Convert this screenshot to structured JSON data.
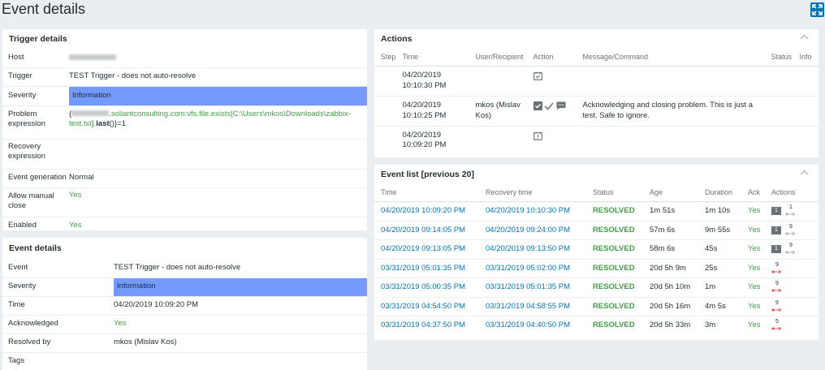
{
  "page": {
    "title": "Event details"
  },
  "trigger_details": {
    "title": "Trigger details",
    "rows": [
      {
        "key": "Host",
        "value": ""
      },
      {
        "key": "Trigger",
        "value": "TEST Trigger - does not auto-resolve"
      },
      {
        "key": "Severity",
        "value": "Information"
      },
      {
        "key": "Problem expression",
        "value_prefix": "{",
        "value_host": ".soliantconsulting.com:vfs.file.exists[C:\\Users\\mkos\\Downloads\\zabbix-test.txt].",
        "value_func": "last",
        "value_suffix": "()}=1"
      },
      {
        "key": "Recovery expression",
        "value": ""
      },
      {
        "key": "Event generation",
        "value": "Normal"
      },
      {
        "key": "Allow manual close",
        "value": "Yes"
      },
      {
        "key": "Enabled",
        "value": "Yes"
      }
    ]
  },
  "event_details": {
    "title": "Event details",
    "rows": [
      {
        "key": "Event",
        "value": "TEST Trigger - does not auto-resolve"
      },
      {
        "key": "Severity",
        "value": "Information"
      },
      {
        "key": "Time",
        "value": "04/20/2019 10:09:20 PM"
      },
      {
        "key": "Acknowledged",
        "value": "Yes"
      },
      {
        "key": "Resolved by",
        "value": "mkos (Mislav Kos)"
      },
      {
        "key": "Tags",
        "value": ""
      }
    ]
  },
  "actions": {
    "title": "Actions",
    "columns": [
      "Step",
      "Time",
      "User/Recipient",
      "Action",
      "Message/Command",
      "Status",
      "Info"
    ],
    "rows": [
      {
        "time_date": "04/20/2019",
        "time_clock": "10:10:30 PM",
        "user": "",
        "action_icons": [
          "calendar-check-icon"
        ],
        "message": ""
      },
      {
        "time_date": "04/20/2019",
        "time_clock": "10:10:25 PM",
        "user": "mkos (Mislav Kos)",
        "action_icons": [
          "checkbox-icon",
          "checkmark-icon",
          "comment-icon"
        ],
        "message": "Acknowledging and closing problem. This is just a test. Safe to ignore."
      },
      {
        "time_date": "04/20/2019",
        "time_clock": "10:09:20 PM",
        "user": "",
        "action_icons": [
          "calendar-exclamation-icon"
        ],
        "message": ""
      }
    ]
  },
  "event_list": {
    "title": "Event list [previous 20]",
    "columns": [
      "Time",
      "Recovery time",
      "Status",
      "Age",
      "Duration",
      "Ack",
      "Actions"
    ],
    "rows": [
      {
        "time": "04/20/2019 10:09:20 PM",
        "recovery": "04/20/2019 10:10:30 PM",
        "status": "RESOLVED",
        "age": "1m 51s",
        "duration": "1m 10s",
        "ack": "Yes",
        "msg_count": "1",
        "action_count": "1"
      },
      {
        "time": "04/20/2019 09:14:05 PM",
        "recovery": "04/20/2019 09:24:00 PM",
        "status": "RESOLVED",
        "age": "57m 6s",
        "duration": "9m 55s",
        "ack": "Yes",
        "msg_count": "1",
        "action_count": "9"
      },
      {
        "time": "04/20/2019 09:13:05 PM",
        "recovery": "04/20/2019 09:13:50 PM",
        "status": "RESOLVED",
        "age": "58m 6s",
        "duration": "45s",
        "ack": "Yes",
        "msg_count": "1",
        "action_count": "9"
      },
      {
        "time": "03/31/2019 05:01:35 PM",
        "recovery": "03/31/2019 05:02:00 PM",
        "status": "RESOLVED",
        "age": "20d 5h 9m",
        "duration": "25s",
        "ack": "Yes",
        "msg_count": "",
        "action_count": "9"
      },
      {
        "time": "03/31/2019 05:00:35 PM",
        "recovery": "03/31/2019 05:01:35 PM",
        "status": "RESOLVED",
        "age": "20d 5h 10m",
        "duration": "1m",
        "ack": "Yes",
        "msg_count": "",
        "action_count": "9"
      },
      {
        "time": "03/31/2019 04:54:50 PM",
        "recovery": "03/31/2019 04:58:55 PM",
        "status": "RESOLVED",
        "age": "20d 5h 16m",
        "duration": "4m 5s",
        "ack": "Yes",
        "msg_count": "",
        "action_count": "9"
      },
      {
        "time": "03/31/2019 04:37:50 PM",
        "recovery": "03/31/2019 04:40:50 PM",
        "status": "RESOLVED",
        "age": "20d 5h 33m",
        "duration": "3m",
        "ack": "Yes",
        "msg_count": "",
        "action_count": "5"
      }
    ]
  },
  "colors": {
    "severity_information": "#7499ff",
    "link": "#0275b8",
    "resolved": "#429e47",
    "accent": "#0275b8"
  }
}
